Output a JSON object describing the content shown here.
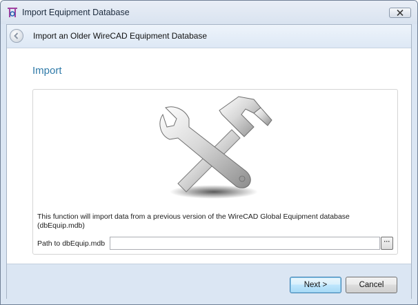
{
  "window": {
    "title": "Import Equipment Database",
    "close_glyph": "✕"
  },
  "wizard": {
    "title": "Import an Older WireCAD Equipment Database",
    "back_icon": "back-arrow-icon"
  },
  "section": {
    "heading": "Import"
  },
  "panel": {
    "illustration": "wrench-hammer-icon",
    "description": "This function will import data from a previous version of the WireCAD Global Equipment database (dbEquip.mdb)",
    "path_label": "Path to dbEquip.mdb",
    "path_value": "",
    "browse_label": "···"
  },
  "buttons": {
    "next": "Next >",
    "cancel": "Cancel"
  },
  "colors": {
    "heading_accent": "#2f7aa8",
    "frame": "#dbe6f3"
  }
}
